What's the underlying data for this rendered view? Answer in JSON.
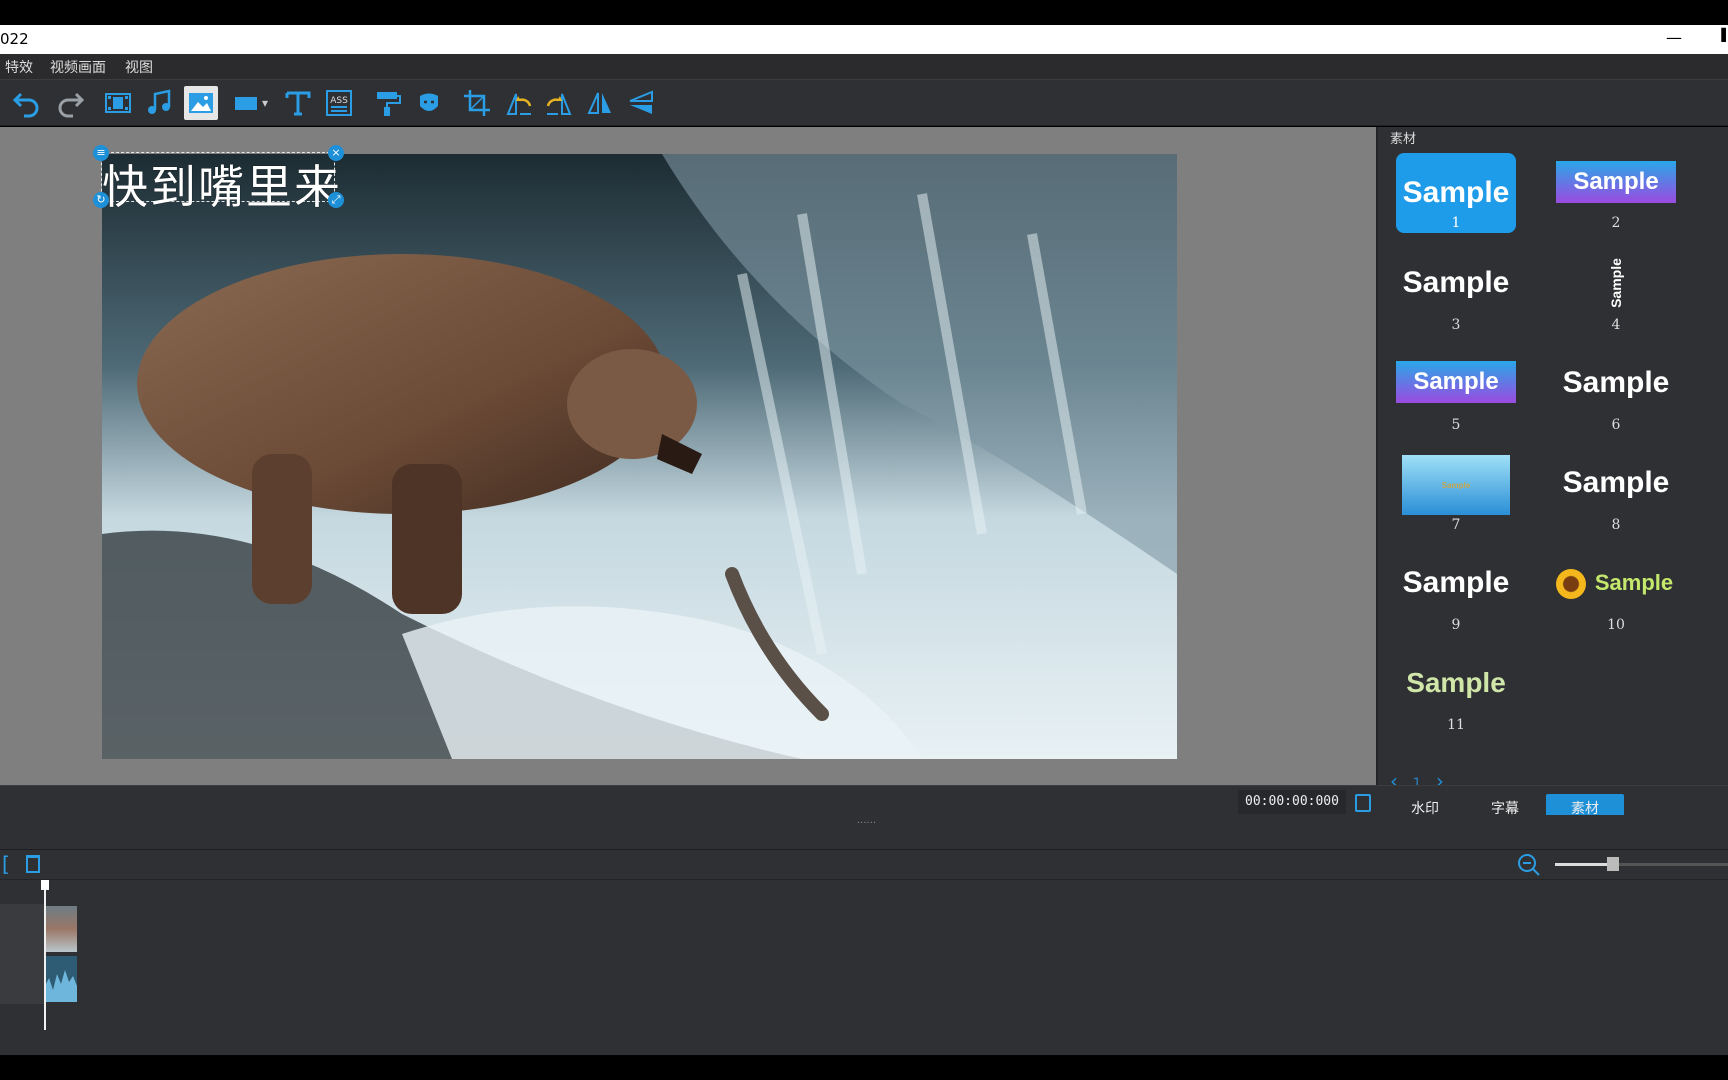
{
  "window": {
    "title": "022",
    "minimize_glyph": "—",
    "edge_glyph": "▌"
  },
  "menu": {
    "items": [
      "特效",
      "视频画面",
      "视图"
    ]
  },
  "toolbar": {
    "icons": [
      "undo-icon",
      "redo-icon",
      "video-icon",
      "music-icon",
      "image-icon",
      "shape-icon",
      "text-icon",
      "ass-subtitle-icon",
      "paint-brush-icon",
      "mask-icon",
      "crop-icon",
      "rotate-left-icon",
      "rotate-right-icon",
      "flip-horizontal-icon",
      "flip-vertical-icon"
    ],
    "ass_label": "ASS",
    "shape_dropdown_glyph": "▾"
  },
  "preview": {
    "overlay_text": "快到嘴里来"
  },
  "right_panel": {
    "header": "素材",
    "samples": [
      {
        "label": "Sample",
        "num": "1"
      },
      {
        "label": "Sample",
        "num": "2"
      },
      {
        "label": "Sample",
        "num": "3"
      },
      {
        "label": "Sample",
        "num": "4"
      },
      {
        "label": "Sample",
        "num": "5"
      },
      {
        "label": "Sample",
        "num": "6"
      },
      {
        "label": "Sample",
        "num": "7"
      },
      {
        "label": "Sample",
        "num": "8"
      },
      {
        "label": "Sample",
        "num": "9"
      },
      {
        "label": "Sample",
        "num": "10"
      },
      {
        "label": "Sample",
        "num": "11"
      }
    ],
    "pager": {
      "prev": "‹",
      "page": "1",
      "next": "›"
    }
  },
  "controls": {
    "timecode": "00:00:00:000",
    "tabs": [
      {
        "label": "水印",
        "active": false
      },
      {
        "label": "字幕",
        "active": false
      },
      {
        "label": "素材",
        "active": true
      }
    ],
    "grip": "......"
  },
  "timeline": {
    "left_bracket": "[",
    "zoom_level": 0.3
  },
  "colors": {
    "accent": "#1e90d8",
    "panel": "#2f3033",
    "preview_bg": "#7f7f7f"
  }
}
